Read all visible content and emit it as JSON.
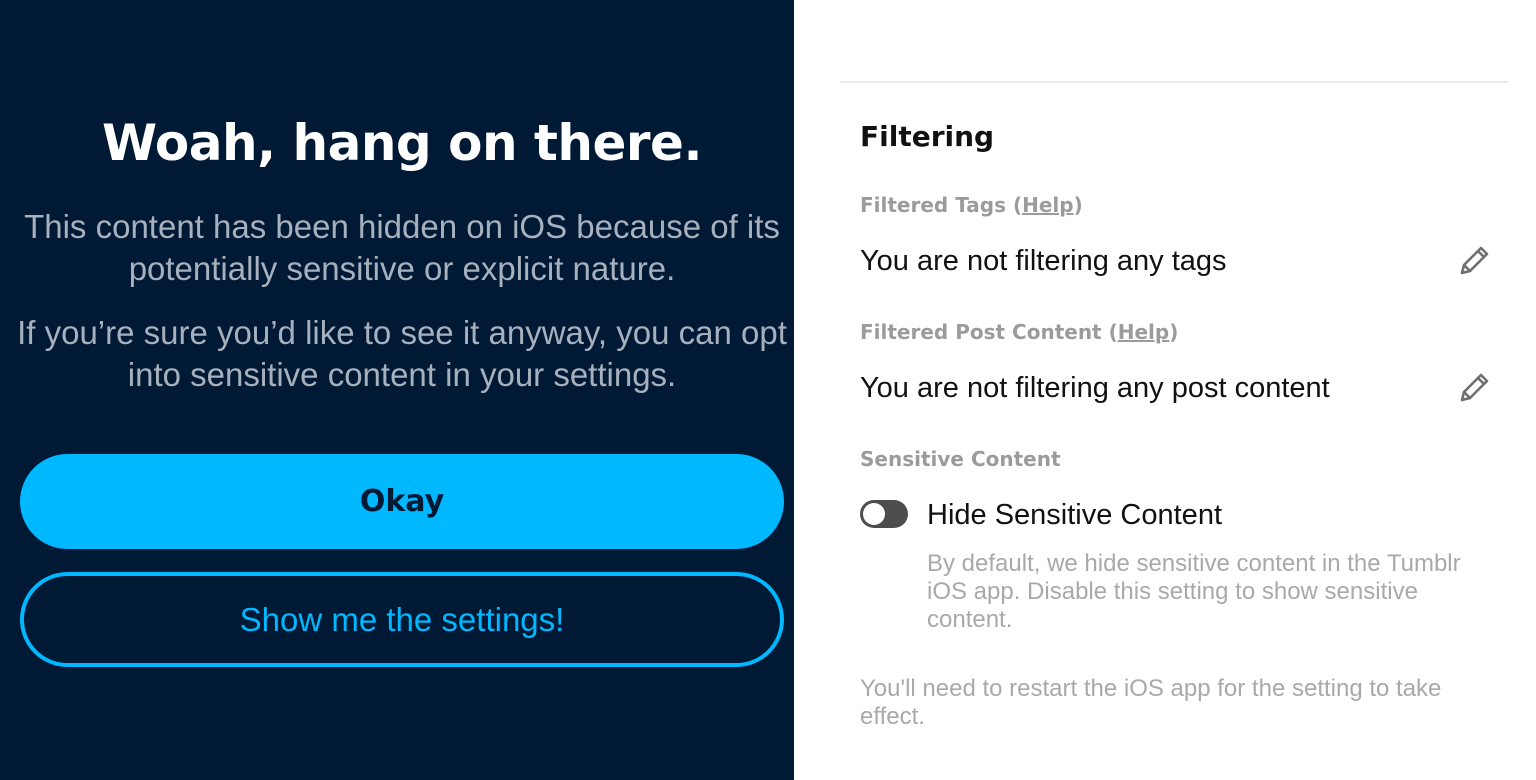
{
  "dialog": {
    "title": "Woah, hang on there.",
    "paragraph1": "This content has been hidden on iOS because of its potentially sensitive or explicit nature.",
    "paragraph2": "If you’re sure you’d like to see it anyway, you can opt into sensitive content in your settings.",
    "okay_label": "Okay",
    "settings_label": "Show me the settings!"
  },
  "settings": {
    "section_title": "Filtering",
    "filtered_tags": {
      "label": "Filtered Tags",
      "help": "Help",
      "value": "You are not filtering any tags",
      "icon": "pencil-icon"
    },
    "filtered_post_content": {
      "label": "Filtered Post Content",
      "help": "Help",
      "value": "You are not filtering any post content",
      "icon": "pencil-icon"
    },
    "sensitive_content": {
      "label": "Sensitive Content",
      "toggle_label": "Hide Sensitive Content",
      "toggle_on": false,
      "description": "By default, we hide sensitive content in the Tumblr iOS app. Disable this setting to show sensitive content."
    },
    "restart_note": "You'll need to restart the iOS app for the setting to take effect."
  },
  "colors": {
    "dialog_background": "#001935",
    "accent": "#00b8ff",
    "dialog_body_text": "#a7b1bd",
    "muted_text": "#9b9b9b"
  }
}
